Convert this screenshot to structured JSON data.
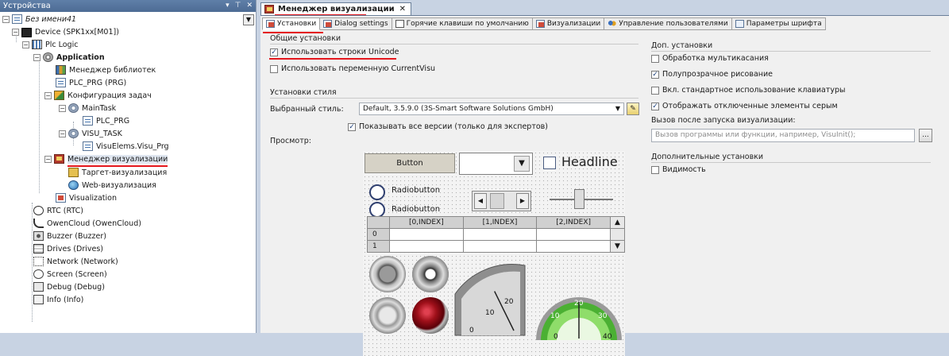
{
  "devices_pane": {
    "title": "Устройства",
    "controls": [
      "▾",
      "⊤",
      "✕"
    ],
    "tree": [
      {
        "label": "Без имени41",
        "icon": "project-icon",
        "style": "italic",
        "expander": "−"
      },
      {
        "label": "Device (SPK1xx[M01])",
        "icon": "device-icon",
        "expander": "−"
      },
      {
        "label": "Plc Logic",
        "icon": "plc-logic-icon",
        "expander": "−"
      },
      {
        "label": "Application",
        "icon": "application-icon",
        "style": "bold",
        "expander": "−"
      },
      {
        "label": "Менеджер библиотек",
        "icon": "library-manager-icon"
      },
      {
        "label": "PLC_PRG (PRG)",
        "icon": "program-icon"
      },
      {
        "label": "Конфигурация задач",
        "icon": "task-configuration-icon",
        "expander": "−"
      },
      {
        "label": "MainTask",
        "icon": "task-icon",
        "expander": "−"
      },
      {
        "label": "PLC_PRG",
        "icon": "program-call-icon"
      },
      {
        "label": "VISU_TASK",
        "icon": "task-icon",
        "expander": "−"
      },
      {
        "label": "VisuElems.Visu_Prg",
        "icon": "program-call-icon"
      },
      {
        "label": "Менеджер визуализации",
        "icon": "visualization-manager-icon",
        "expander": "−",
        "selected": true
      },
      {
        "label": "Таргет-визуализация",
        "icon": "target-visualization-icon"
      },
      {
        "label": "Web-визуализация",
        "icon": "web-visualization-icon"
      },
      {
        "label": "Visualization",
        "icon": "visualization-icon"
      },
      {
        "label": "RTC (RTC)",
        "icon": "clock-icon"
      },
      {
        "label": "OwenCloud (OwenCloud)",
        "icon": "cloud-icon"
      },
      {
        "label": "Buzzer (Buzzer)",
        "icon": "buzzer-icon"
      },
      {
        "label": "Drives (Drives)",
        "icon": "drives-icon"
      },
      {
        "label": "Network (Network)",
        "icon": "network-icon"
      },
      {
        "label": "Screen (Screen)",
        "icon": "screen-icon"
      },
      {
        "label": "Debug (Debug)",
        "icon": "debug-icon"
      },
      {
        "label": "Info (Info)",
        "icon": "info-icon"
      }
    ]
  },
  "editor": {
    "doc_tab": {
      "label": "Менеджер визуализации",
      "close": "✕"
    },
    "subtabs": [
      {
        "label": "Установки",
        "active": true
      },
      {
        "label": "Dialog settings"
      },
      {
        "label": "Горячие клавиши по умолчанию"
      },
      {
        "label": "Визуализации"
      },
      {
        "label": "Управление пользователями"
      },
      {
        "label": "Параметры шрифта"
      }
    ],
    "general": {
      "title": "Общие установки",
      "use_unicode": {
        "label": "Использовать строки Unicode",
        "checked": true
      },
      "use_currentvisu": {
        "label": "Использовать переменную CurrentVisu",
        "checked": false
      }
    },
    "style": {
      "title": "Установки стиля",
      "selected_label": "Выбранный стиль:",
      "selected_value": "Default, 3.5.9.0 (3S-Smart Software Solutions GmbH)",
      "show_all_versions": {
        "label": "Показывать все версии (только для экспертов)",
        "checked": true
      },
      "preview_label": "Просмотр:"
    },
    "preview": {
      "button_label": "Button",
      "headline": "Headline",
      "radio1": "Radiobutton",
      "radio2": "Radiobutton",
      "table_headers": [
        "[0,INDEX]",
        "[1,INDEX]",
        "[2,INDEX]"
      ],
      "table_rows": [
        "0",
        "1"
      ],
      "meter1_ticks": [
        "0",
        "10",
        "20"
      ],
      "meter2_ticks": [
        "0",
        "10",
        "20",
        "30",
        "40"
      ],
      "meter1_value": 0.62,
      "meter2_value": 0.5
    },
    "additional": {
      "title": "Доп. установки",
      "multitouch": {
        "label": "Обработка мультикасания",
        "checked": false
      },
      "semitransparent": {
        "label": "Полупрозрачное рисование",
        "checked": true
      },
      "keyboard": {
        "label": "Вкл. стандартное использование клавиатуры",
        "checked": false
      },
      "show_disabled_gray": {
        "label": "Отображать отключенные элементы серым",
        "checked": true
      },
      "call_after_start_label": "Вызов после запуска визуализации:",
      "call_after_start_placeholder": "Вызов программы или функции, например, VisuInit();",
      "browse_label": "..."
    },
    "extra": {
      "title": "Дополнительные установки",
      "visibility": {
        "label": "Видимость",
        "checked": false
      }
    }
  },
  "colors": {
    "accent_underline": "#e4171d",
    "title_bar": "#4d6b94",
    "check_mark": "#1c3f7a"
  }
}
